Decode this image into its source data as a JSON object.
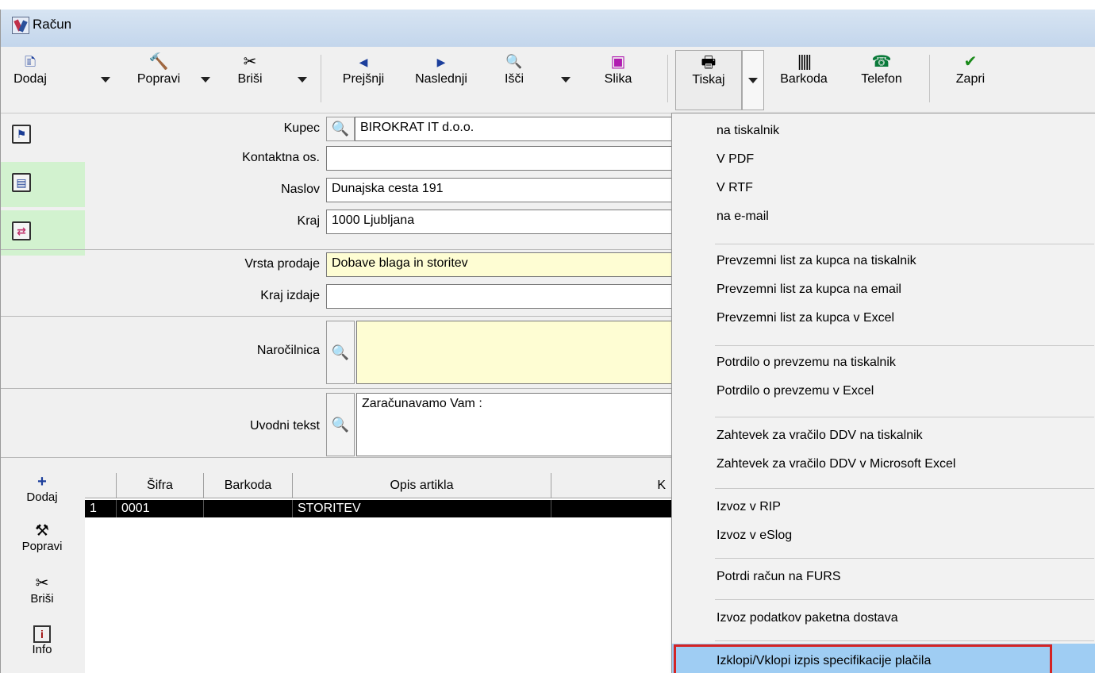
{
  "window": {
    "title": "Račun"
  },
  "toolbar": {
    "dodaj": "Dodaj",
    "popravi": "Popravi",
    "brisi": "Briši",
    "prejsnji": "Prejšnji",
    "naslednji": "Naslednji",
    "isci": "Išči",
    "slika": "Slika",
    "tiskaj": "Tiskaj",
    "barkoda": "Barkoda",
    "telefon": "Telefon",
    "zapri": "Zapri"
  },
  "form": {
    "kupec_label": "Kupec",
    "kupec_value": "BIROKRAT IT d.o.o.",
    "kontaktna_label": "Kontaktna os.",
    "kontaktna_value": "",
    "naslov_label": "Naslov",
    "naslov_value": "Dunajska cesta 191",
    "kraj_label": "Kraj",
    "kraj_value": "1000 Ljubljana",
    "vrsta_label": "Vrsta prodaje",
    "vrsta_value": "Dobave blaga in storitev",
    "kraj_izdaje_label": "Kraj izdaje",
    "kraj_izdaje_value": "",
    "narocilnica_label": "Naročilnica",
    "narocilnica_value": "",
    "uvodni_label": "Uvodni tekst",
    "uvodni_value": "Zaračunavamo Vam :"
  },
  "table": {
    "columns": [
      "Šifra",
      "Barkoda",
      "Opis artikla",
      "K"
    ],
    "rows": [
      {
        "num": "1",
        "sifra": "0001",
        "barkoda": "",
        "opis": "STORITEV"
      }
    ]
  },
  "side": {
    "dodaj": "Dodaj",
    "popravi": "Popravi",
    "brisi": "Briši",
    "info": "Info"
  },
  "menu": {
    "items": [
      "na tiskalnik",
      "V PDF",
      "V RTF",
      "na e-mail",
      "Prevzemni list za kupca na tiskalnik",
      "Prevzemni list za kupca na email",
      "Prevzemni list za kupca v Excel",
      "Potrdilo o prevzemu na tiskalnik",
      "Potrdilo o prevzemu v Excel",
      "Zahtevek za vračilo DDV na tiskalnik",
      "Zahtevek za vračilo DDV v Microsoft Excel",
      "Izvoz v RIP",
      "Izvoz v eSlog",
      "Potrdi račun na FURS",
      "Izvoz podatkov paketna dostava",
      "Izklopi/Vklopi izpis specifikacije plačila"
    ],
    "highlighted_color": "#9fcdf3",
    "annotation_color": "#d42424"
  }
}
